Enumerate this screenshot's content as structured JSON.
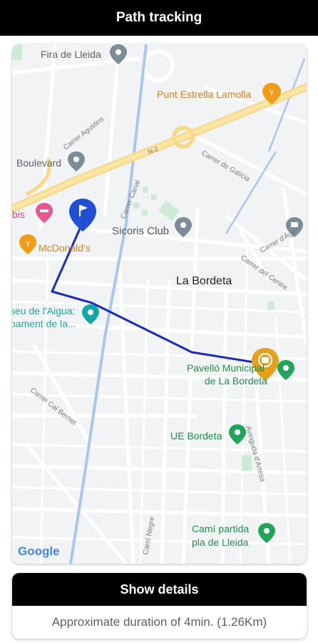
{
  "header": {
    "title": "Path tracking"
  },
  "map": {
    "labels": {
      "fira": "Fira de Lleida",
      "punt": "Punt Estrella Lamolla",
      "carrer_agustins": "Carrer Agustins",
      "n2": "N-2",
      "carrer_galicia": "Carrer de Galícia",
      "boulevard": "Boulevard",
      "carrer_canal": "Carrer Canal",
      "ibis": "Ibis",
      "sicoris": "Sicoris Club",
      "mcdonalds": "McDonald's",
      "carrer_agar": "Carrer d'Àger",
      "carrer_centre": "Carrer del Centre",
      "la_bordeta": "La Bordeta",
      "museu_1": "seu de l'Aigua:",
      "museu_2": "pament de la...",
      "pavello_1": "Pavelló Municipal",
      "pavello_2": "de La Bordeta",
      "carrer_bernet": "Carrer Cal Bernet",
      "ue_bordeta": "UE Bordeta",
      "av_artesa": "Avinguda d'Artesa",
      "cami_negre": "Camí Negre",
      "cami_partida_1": "Camí partida",
      "cami_partida_2": "pla de Lleida",
      "google": "Google"
    },
    "route_color": "#1a2bc4",
    "start_marker_color": "#1e4fd4",
    "end_marker_color": "#e6a11a"
  },
  "details": {
    "button_label": "Show details",
    "duration": "Approximate duration of 4min. (1.26Km)"
  }
}
